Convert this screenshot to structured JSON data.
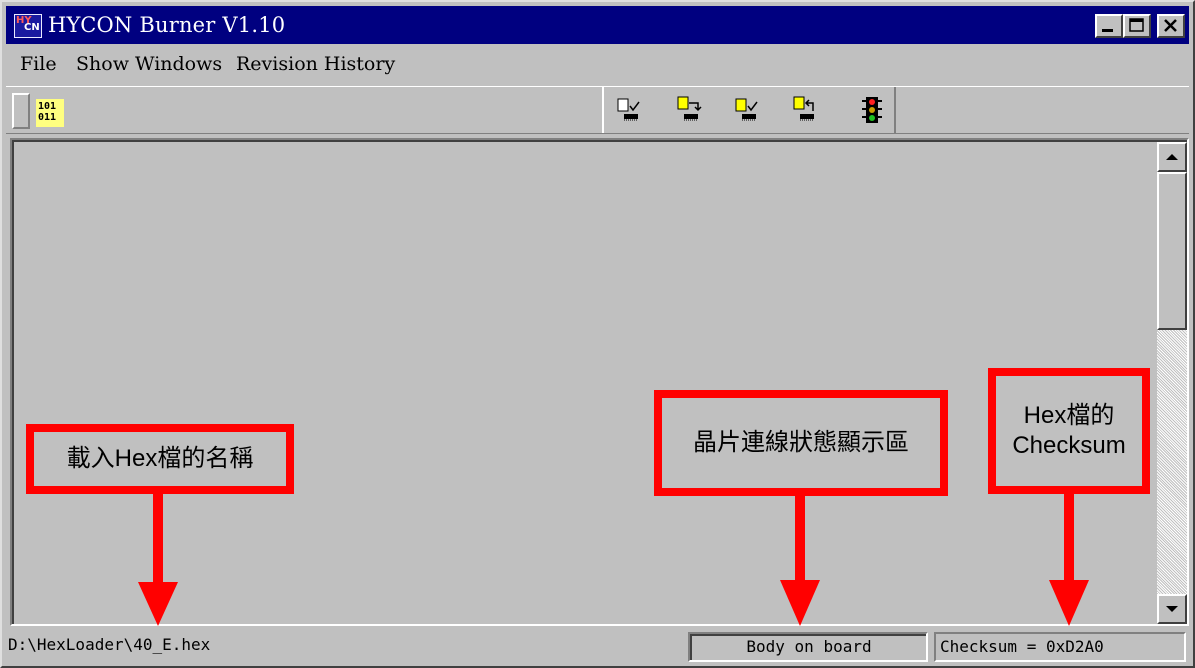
{
  "window": {
    "title": "HYCON Burner V1.10",
    "icon_text_top": "HY",
    "icon_text_bottom": "CN"
  },
  "menu": [
    "File",
    "Show Windows",
    "Revision History"
  ],
  "toolbar": {
    "binary_icon_lines": [
      "101",
      "011"
    ],
    "buttons": [
      {
        "name": "verify-icon"
      },
      {
        "name": "load-icon"
      },
      {
        "name": "check-icon"
      },
      {
        "name": "read-icon"
      },
      {
        "name": "traffic-light-icon"
      }
    ]
  },
  "annotations": {
    "hex_name": "載入Hex檔的名稱",
    "chip_status": "晶片連線狀態顯示區",
    "checksum": "Hex檔的\nChecksum",
    "color": "#ff0000"
  },
  "status": {
    "file_path": "D:\\HexLoader\\40_E.hex",
    "board_status": "Body on board",
    "checksum": "Checksum = 0xD2A0"
  }
}
